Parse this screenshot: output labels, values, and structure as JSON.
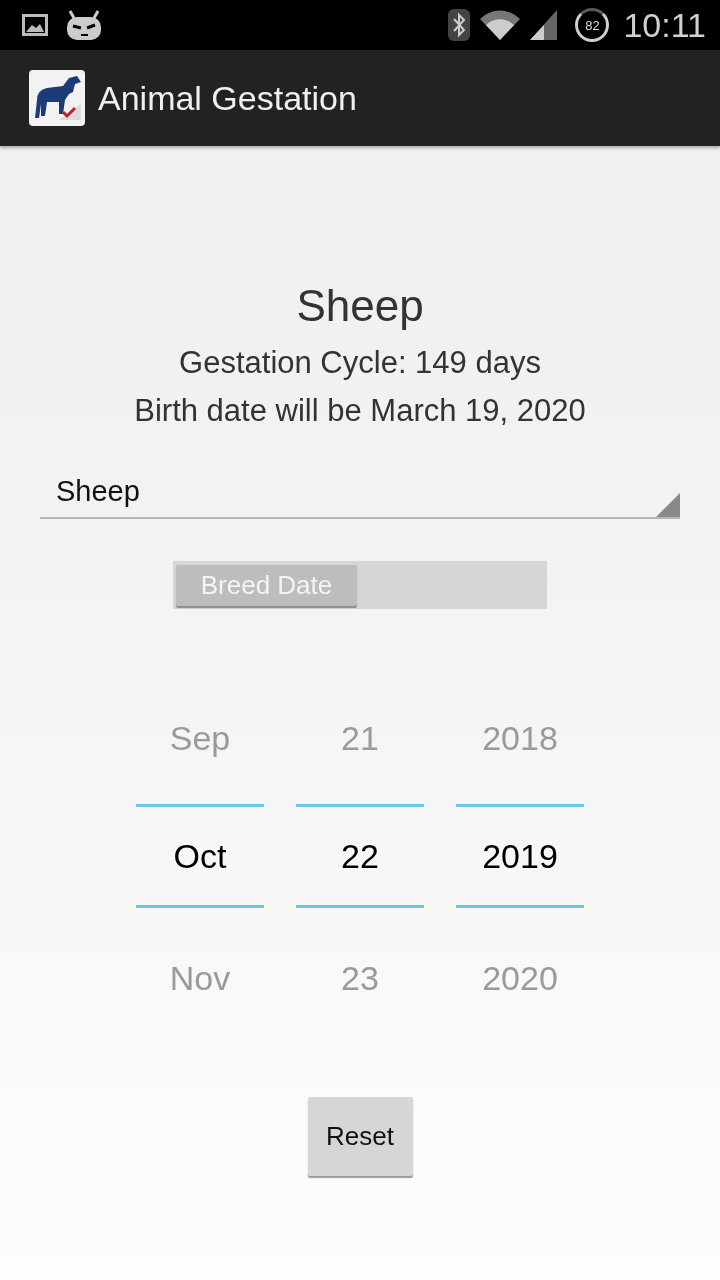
{
  "status_bar": {
    "battery": "82",
    "time": "10:11"
  },
  "action_bar": {
    "title": "Animal Gestation"
  },
  "summary": {
    "animal": "Sheep",
    "cycle": "Gestation Cycle: 149 days",
    "birth_date": "Birth date will be March 19, 2020"
  },
  "animal_spinner": {
    "value": "Sheep"
  },
  "date_switch": {
    "label": "Breed Date",
    "on": false
  },
  "date_picker": {
    "columns": [
      {
        "items": [
          {
            "value": "Sep",
            "selected": false
          },
          {
            "value": "Oct",
            "selected": true
          },
          {
            "value": "Nov",
            "selected": false
          }
        ]
      },
      {
        "items": [
          {
            "value": "21",
            "selected": false
          },
          {
            "value": "22",
            "selected": true
          },
          {
            "value": "23",
            "selected": false
          }
        ]
      },
      {
        "items": [
          {
            "value": "2018",
            "selected": false
          },
          {
            "value": "2019",
            "selected": true
          },
          {
            "value": "2020",
            "selected": false
          }
        ]
      }
    ]
  },
  "buttons": [
    "Reset"
  ]
}
